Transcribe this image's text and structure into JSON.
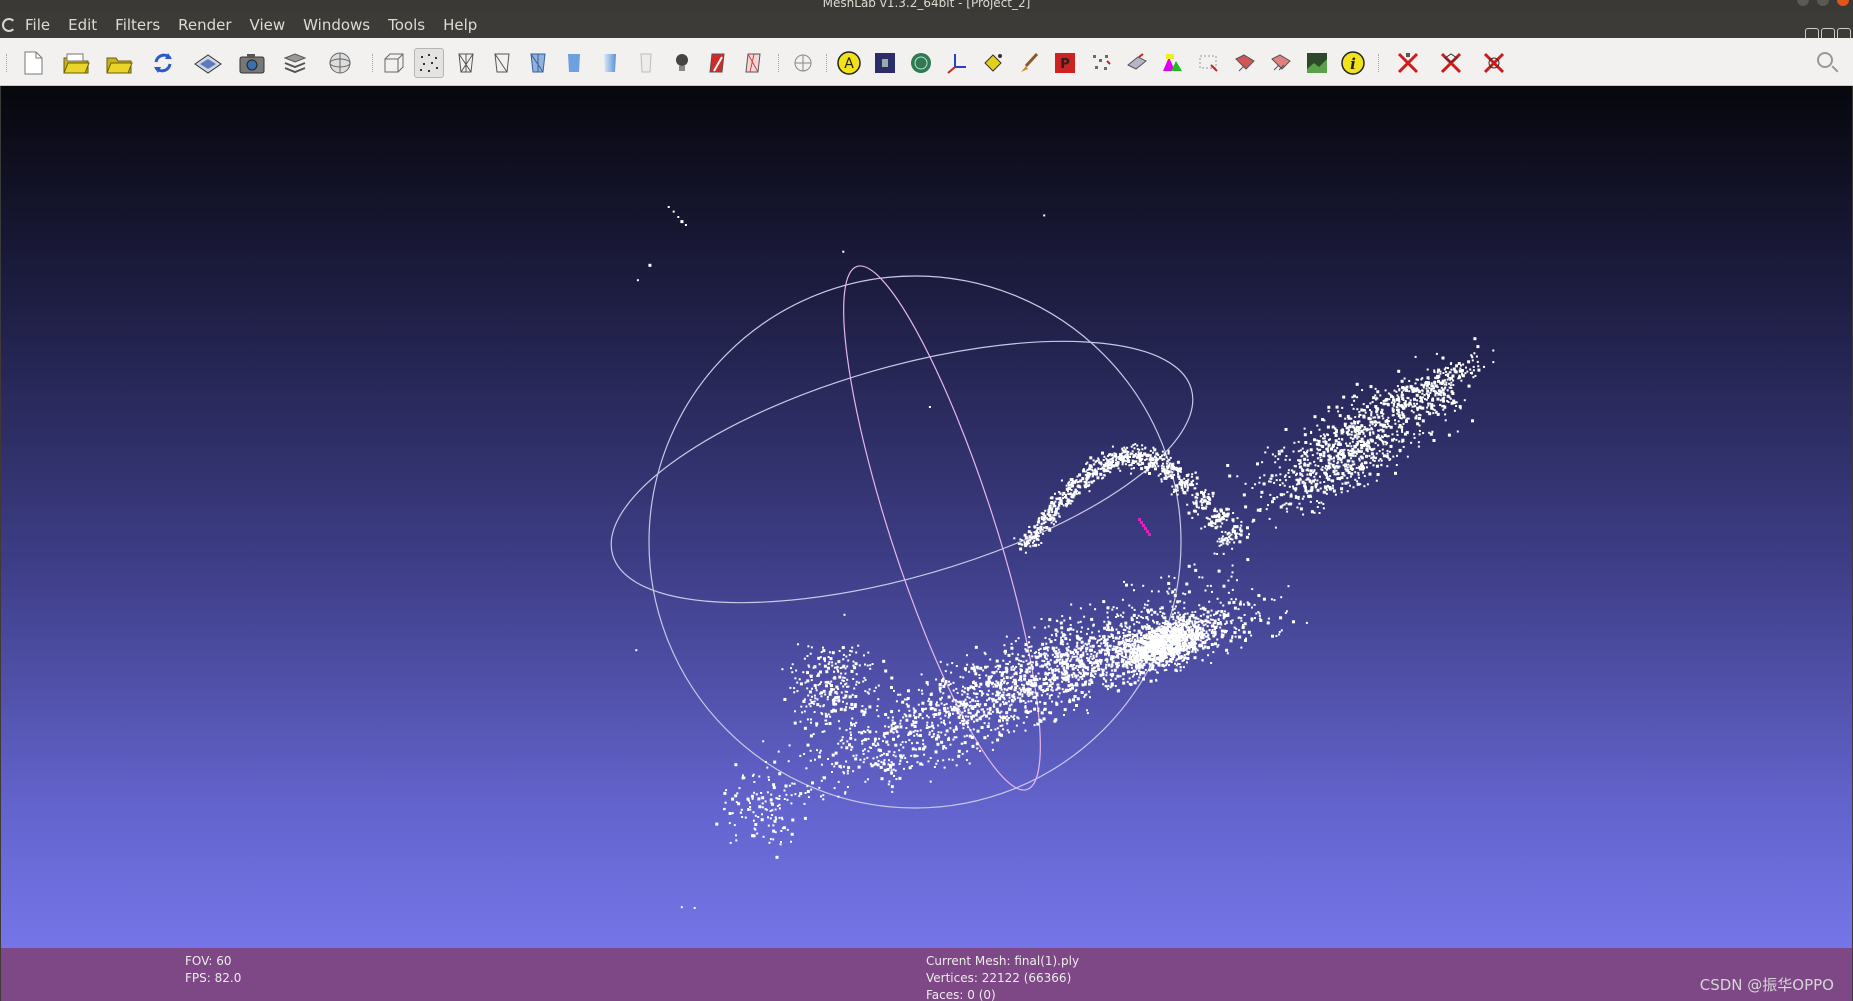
{
  "window": {
    "title": "MeshLab v1.3.2_64bit - [Project_2]"
  },
  "menu": {
    "items": [
      "File",
      "Edit",
      "Filters",
      "Render",
      "View",
      "Windows",
      "Tools",
      "Help"
    ]
  },
  "toolbar": {
    "icons": [
      "new-project-icon",
      "open-project-icon",
      "import-mesh-icon",
      "reload-icon",
      "save-icon",
      "snapshot-icon",
      "layers-icon",
      "trackball-icon",
      "bounding-box-icon",
      "points-icon",
      "wireframe-icon",
      "hidden-lines-icon",
      "flat-lines-icon",
      "flat-icon",
      "smooth-icon",
      "texture-icon",
      "light-icon",
      "backface-icon",
      "two-side-icon",
      "decorate-axis-icon",
      "annotation-icon",
      "shader-icon",
      "texture-map-icon",
      "axis-icon",
      "paint-bucket-icon",
      "paint-brush-icon",
      "pickpoints-icon",
      "align-icon",
      "measure-icon",
      "colorize-icon",
      "select-vertices-icon",
      "select-faces-icon",
      "select-connected-icon",
      "raster-icon",
      "info-icon",
      "delete-vertices-icon",
      "delete-faces-icon",
      "delete-all-icon"
    ],
    "active": "points-icon"
  },
  "viewport": {
    "background_top": "#07070d",
    "background_bottom": "#7575e8",
    "point_color": "#ffffff",
    "trackball_color": "#c8c8e6",
    "highlight_color": "#e020c0"
  },
  "status": {
    "fov": "FOV: 60",
    "fps": "FPS:    82.0",
    "current_mesh": "Current Mesh: final(1).ply",
    "vertices": "Vertices: 22122 (66366)",
    "faces": "Faces: 0 (0)",
    "watermark": "CSDN @振华OPPO"
  }
}
